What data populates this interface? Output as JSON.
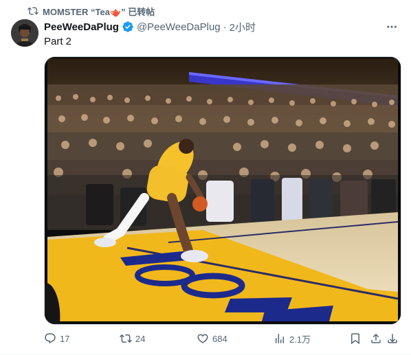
{
  "retweet": {
    "text": "MOMSTER “Tea🫖” 已转帖",
    "icon": "retweet-icon"
  },
  "author": {
    "name": "PeeWeeDaPlug",
    "handle": "@PeeWeeDaPlug",
    "separator": "·",
    "time": "2小时",
    "verified": true,
    "verified_color": "#1d9bf0"
  },
  "tweet": {
    "text": "Part 2"
  },
  "media": {
    "type": "video-frame"
  },
  "actions": {
    "reply": {
      "count": "17",
      "icon": "reply-icon"
    },
    "retweet": {
      "count": "24",
      "icon": "retweet-icon"
    },
    "like": {
      "count": "684",
      "icon": "heart-icon"
    },
    "views": {
      "count": "2.1万",
      "icon": "views-icon"
    },
    "bookmark": {
      "icon": "bookmark-icon"
    },
    "share": {
      "icon": "share-icon"
    },
    "download": {
      "icon": "download-icon"
    }
  },
  "colors": {
    "text_secondary": "#536471",
    "accent": "#1d9bf0"
  }
}
